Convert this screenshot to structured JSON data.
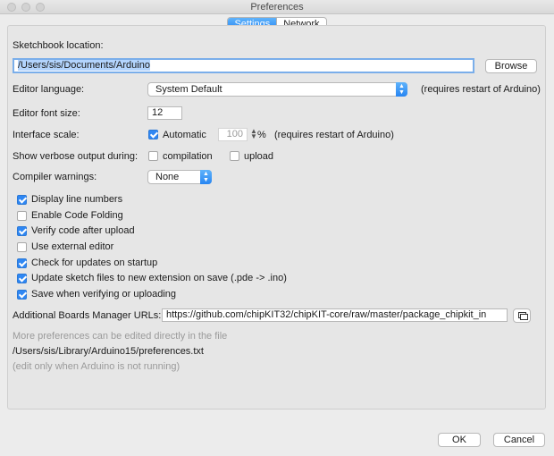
{
  "window": {
    "title": "Preferences"
  },
  "tabs": [
    {
      "label": "Settings",
      "active": true
    },
    {
      "label": "Network",
      "active": false
    }
  ],
  "settings": {
    "sketchbook_label": "Sketchbook location:",
    "sketchbook_path": "/Users/sis/Documents/Arduino",
    "browse_label": "Browse",
    "editor_language_label": "Editor language:",
    "editor_language_value": "System Default",
    "editor_language_note": "(requires restart of Arduino)",
    "font_size_label": "Editor font size:",
    "font_size_value": "12",
    "interface_scale_label": "Interface scale:",
    "automatic_label": "Automatic",
    "automatic_checked": true,
    "scale_value": "100",
    "scale_unit": "%",
    "scale_note": "(requires restart of Arduino)",
    "verbose_label": "Show verbose output during:",
    "verbose_compilation_label": "compilation",
    "verbose_upload_label": "upload",
    "compiler_warnings_label": "Compiler warnings:",
    "compiler_warnings_value": "None",
    "checkboxes": [
      {
        "label": "Display line numbers",
        "checked": true
      },
      {
        "label": "Enable Code Folding",
        "checked": false
      },
      {
        "label": "Verify code after upload",
        "checked": true
      },
      {
        "label": "Use external editor",
        "checked": false
      },
      {
        "label": "Check for updates on startup",
        "checked": true
      },
      {
        "label": "Update sketch files to new extension on save (.pde -> .ino)",
        "checked": true
      },
      {
        "label": "Save when verifying or uploading",
        "checked": true
      }
    ],
    "boards_urls_label": "Additional Boards Manager URLs:",
    "boards_urls_value": "https://github.com/chipKIT32/chipKIT-core/raw/master/package_chipkit_in",
    "more_prefs_note": "More preferences can be edited directly in the file",
    "prefs_path": "/Users/sis/Library/Arduino15/preferences.txt",
    "edit_note": "(edit only when Arduino is not running)"
  },
  "footer": {
    "ok_label": "OK",
    "cancel_label": "Cancel"
  },
  "icons": {
    "window_controls": [
      "close-icon",
      "minimize-icon",
      "zoom-icon"
    ],
    "url_list": "window-list-icon",
    "popup_arrows": "chevron-updown-icon"
  },
  "colors": {
    "accent": "#2f87f3",
    "selection": "#b3d4fd"
  }
}
